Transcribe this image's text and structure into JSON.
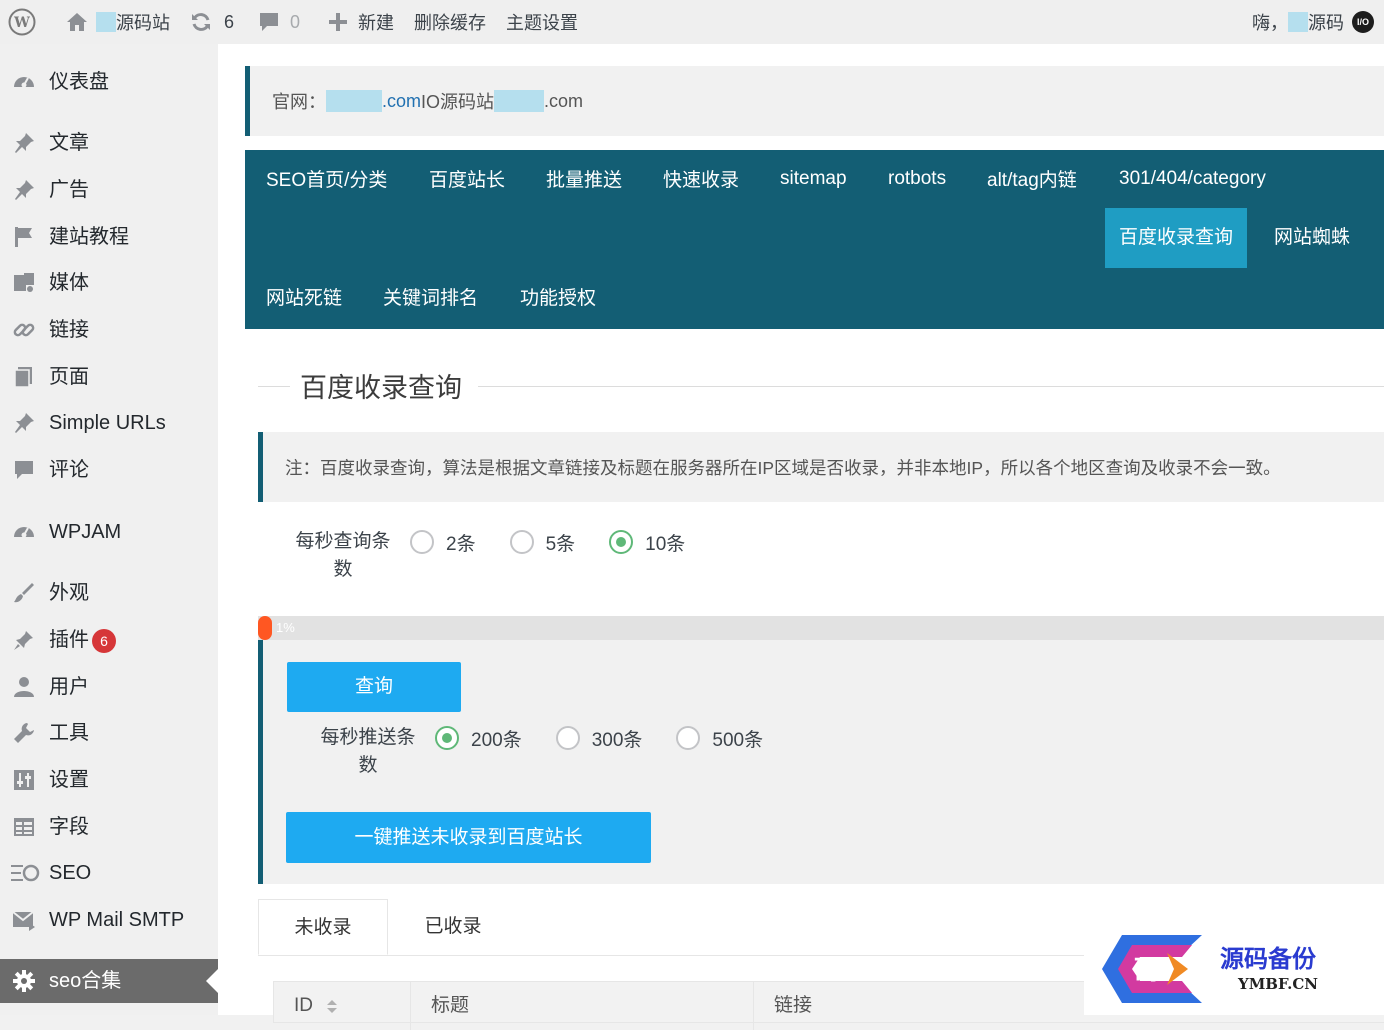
{
  "adminbar": {
    "site_name_suffix": "源码站",
    "updates_count": "6",
    "comments_count": "0",
    "new_label": "新建",
    "clear_cache_label": "删除缓存",
    "theme_settings_label": "主题设置",
    "greeting": "嗨，",
    "user_suffix": "源码",
    "avatar_text": "I/O"
  },
  "sidebar": {
    "items": [
      {
        "label": "仪表盘",
        "icon": "dashboard-icon"
      },
      {
        "label": "文章",
        "icon": "pin-icon"
      },
      {
        "label": "广告",
        "icon": "pin-icon"
      },
      {
        "label": "建站教程",
        "icon": "flag-icon"
      },
      {
        "label": "媒体",
        "icon": "media-icon"
      },
      {
        "label": "链接",
        "icon": "link-icon"
      },
      {
        "label": "页面",
        "icon": "page-icon"
      },
      {
        "label": "Simple URLs",
        "icon": "pin-icon"
      },
      {
        "label": "评论",
        "icon": "comment-icon"
      },
      {
        "label": "WPJAM",
        "icon": "dashboard-icon"
      },
      {
        "label": "外观",
        "icon": "brush-icon"
      },
      {
        "label": "插件",
        "icon": "plugin-icon",
        "badge": "6"
      },
      {
        "label": "用户",
        "icon": "user-icon"
      },
      {
        "label": "工具",
        "icon": "wrench-icon"
      },
      {
        "label": "设置",
        "icon": "settings-icon"
      },
      {
        "label": "字段",
        "icon": "table-icon"
      },
      {
        "label": "SEO",
        "icon": "seo-icon"
      },
      {
        "label": "WP Mail SMTP",
        "icon": "mail-icon"
      },
      {
        "label": "seo合集",
        "icon": "gear-icon",
        "current": true
      }
    ]
  },
  "notice": {
    "prefix": "官网：",
    "link_suffix": ".com",
    "middle": " IO源码站",
    "suffix": ".com"
  },
  "tabs": [
    "SEO首页/分类",
    "百度站长",
    "批量推送",
    "快速收录",
    "sitemap",
    "rotbots",
    "alt/tag内链",
    "301/404/category",
    "百度收录查询",
    "网站蜘蛛",
    "网站死链",
    "关键词排名",
    "功能授权"
  ],
  "active_tab": "百度收录查询",
  "section_title": "百度收录查询",
  "note": "注：百度收录查询，算法是根据文章链接及标题在服务器所在IP区域是否收录，并非本地IP，所以各个地区查询及收录不会一致。",
  "query_rate": {
    "label_line1": "每秒查询条",
    "label_line2": "数",
    "options": [
      "2条",
      "5条",
      "10条"
    ],
    "selected": "10条"
  },
  "progress": {
    "value": 0.01,
    "text": "1%"
  },
  "query_button": "查询",
  "push_rate": {
    "label_line1": "每秒推送条",
    "label_line2": "数",
    "options": [
      "200条",
      "300条",
      "500条"
    ],
    "selected": "200条"
  },
  "push_button": "一键推送未收录到百度站长",
  "result_tabs": [
    "未收录",
    "已收录"
  ],
  "table": {
    "columns": [
      "ID",
      "标题",
      "链接"
    ]
  },
  "watermark": {
    "logo_char": "码",
    "line1": "源码备份",
    "line2": "YMBF.CN"
  },
  "colors": {
    "tabs_bg": "#135e74",
    "tab_active": "#1f9dc3",
    "button": "#1eaaf1",
    "radio_checked": "#5fb878",
    "progress": "#ff5722",
    "badge": "#d63638"
  }
}
